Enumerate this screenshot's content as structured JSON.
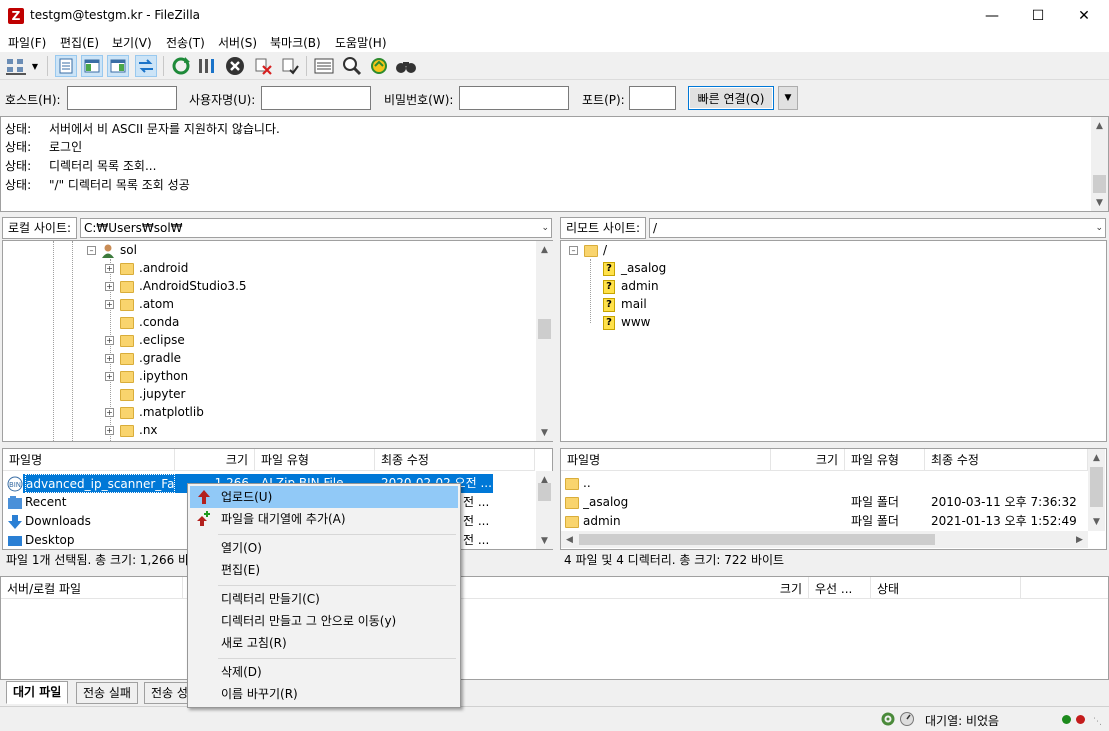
{
  "window": {
    "title": "testgm@testgm.kr - FileZilla",
    "app_icon_letter": "Z"
  },
  "menu": [
    "파일(F)",
    "편집(E)",
    "보기(V)",
    "전송(T)",
    "서버(S)",
    "북마크(B)",
    "도움말(H)"
  ],
  "quickconnect": {
    "host_label": "호스트(H):",
    "user_label": "사용자명(U):",
    "pass_label": "비밀번호(W):",
    "port_label": "포트(P):",
    "connect_label": "빠른 연결(Q)"
  },
  "log": [
    {
      "k": "상태:",
      "v": "서버에서 비 ASCII 문자를 지원하지 않습니다."
    },
    {
      "k": "상태:",
      "v": "로그인"
    },
    {
      "k": "상태:",
      "v": "디렉터리 목록 조회..."
    },
    {
      "k": "상태:",
      "v": "\"/\" 디렉터리 목록 조회 성공"
    }
  ],
  "local": {
    "label": "로컬 사이트:",
    "path": "C:₩Users₩sol₩",
    "user_folder": "sol",
    "tree": [
      ".android",
      ".AndroidStudio3.5",
      ".atom",
      ".conda",
      ".eclipse",
      ".gradle",
      ".ipython",
      ".jupyter",
      ".matplotlib",
      ".nx"
    ],
    "columns": [
      "파일명",
      "크기",
      "파일 유형",
      "최종 수정"
    ],
    "files": [
      {
        "name": "advanced_ip_scanner_Fav...",
        "size": "1,266",
        "type": "ALZip BIN File",
        "modified": "2020-02-02 오전 ..."
      },
      {
        "name": "Recent",
        "size": "",
        "type": "",
        "modified": "전 ..."
      },
      {
        "name": "Downloads",
        "size": "",
        "type": "",
        "modified": "전 ..."
      },
      {
        "name": "Desktop",
        "size": "",
        "type": "",
        "modified": "전 ..."
      }
    ],
    "status": "파일 1개 선택됨. 총 크기: 1,266 바"
  },
  "remote": {
    "label": "리모트 사이트:",
    "path": "/",
    "root": "/",
    "tree": [
      "_asalog",
      "admin",
      "mail",
      "www"
    ],
    "columns": [
      "파일명",
      "크기",
      "파일 유형",
      "최종 수정"
    ],
    "files": [
      {
        "name": "..",
        "type": "",
        "modified": ""
      },
      {
        "name": "_asalog",
        "type": "파일 폴더",
        "modified": "2010-03-11 오후 7:36:32"
      },
      {
        "name": "admin",
        "type": "파일 폴더",
        "modified": "2021-01-13 오후 1:52:49"
      }
    ],
    "status": "4 파일 및 4 디렉터리. 총 크기: 722 바이트"
  },
  "queue": {
    "columns": [
      "서버/로컬 파일",
      "크기",
      "우선 ...",
      "상태"
    ]
  },
  "tabs": [
    "대기 파일",
    "전송 실패",
    "전송 성"
  ],
  "bottom": {
    "queue_status": "대기열: 비었음"
  },
  "context_menu": {
    "items": [
      "업로드(U)",
      "파일을 대기열에 추가(A)",
      "열기(O)",
      "편집(E)",
      "디렉터리 만들기(C)",
      "디렉터리 만들고 그 안으로 이동(y)",
      "새로 고침(R)",
      "삭제(D)",
      "이름 바꾸기(R)"
    ]
  },
  "colors": {
    "selection": "#0078d7",
    "menu_highlight": "#91c9f7",
    "folder": "#f9d46d"
  }
}
